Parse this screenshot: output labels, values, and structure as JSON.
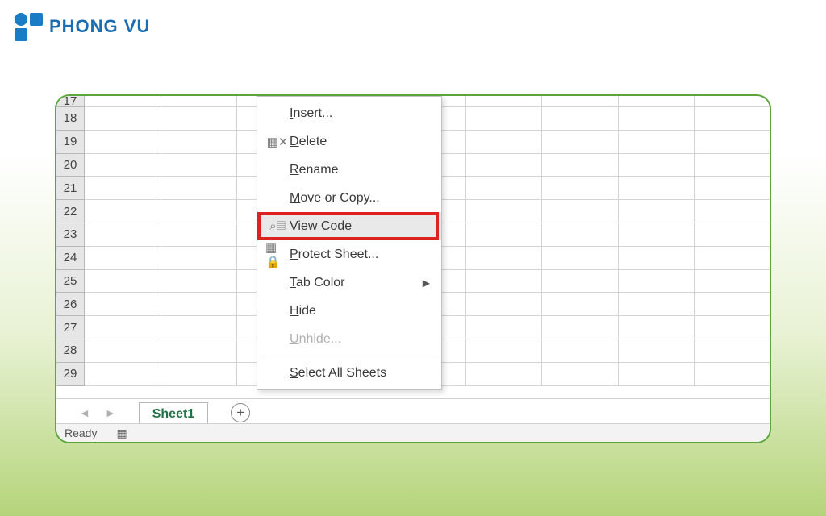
{
  "logo": {
    "text": "PHONG VU"
  },
  "rows": [
    17,
    18,
    19,
    20,
    21,
    22,
    23,
    24,
    25,
    26,
    27,
    28,
    29
  ],
  "sheet_tab": "Sheet1",
  "status": "Ready",
  "add_sheet_glyph": "+",
  "nav": {
    "prev": "◄",
    "next": "►"
  },
  "menu": {
    "insert": "Insert...",
    "delete": "Delete",
    "rename": "Rename",
    "move": "Move or Copy...",
    "view_code": "View Code",
    "protect": "Protect Sheet...",
    "tab_color": "Tab Color",
    "hide": "Hide",
    "unhide": "Unhide...",
    "select_all": "Select All Sheets"
  }
}
